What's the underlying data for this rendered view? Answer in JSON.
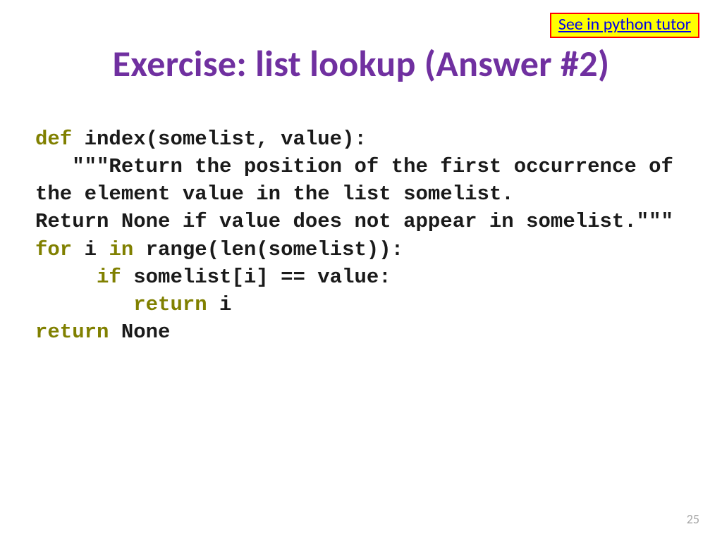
{
  "link": {
    "label": "See in python tutor"
  },
  "title": "Exercise:  list lookup (Answer #2)",
  "code": {
    "kw_def": "def",
    "sig_rest": " index(somelist, value):",
    "doc1": "   \"\"\"Return the position of the first occurrence of the element value in the list somelist.",
    "doc2": "Return None if value does not appear in somelist.\"\"\"",
    "kw_for": "for",
    "for_mid": " i ",
    "kw_in": "in",
    "for_rest": " range(len(somelist)):",
    "if_indent": "     ",
    "kw_if": "if",
    "if_rest": " somelist[i] == value:",
    "ret_indent": "        ",
    "kw_return1": "return",
    "ret_rest": " i",
    "kw_return2": "return",
    "none_rest": " None"
  },
  "page_number": "25"
}
